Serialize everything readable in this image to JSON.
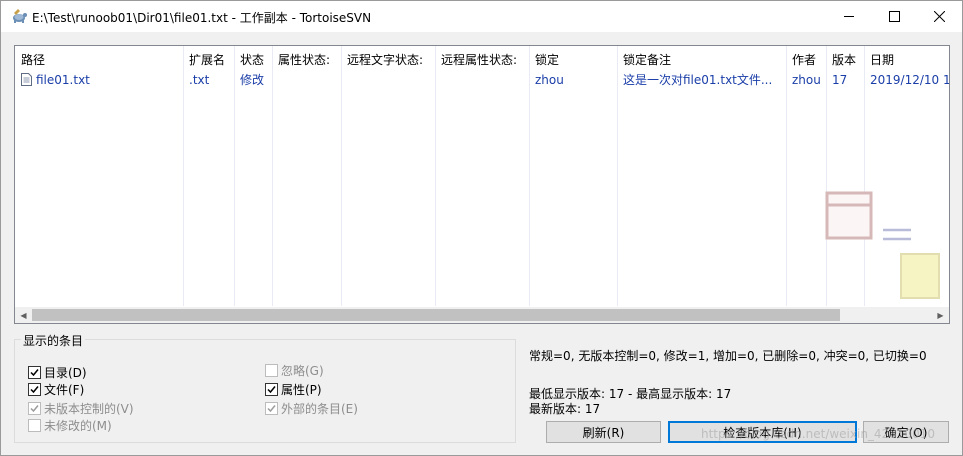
{
  "window": {
    "title": "E:\\Test\\runoob01\\Dir01\\file01.txt - 工作副本 - TortoiseSVN",
    "icon": "tortoise-icon"
  },
  "list": {
    "columns": [
      "路径",
      "扩展名",
      "状态",
      "属性状态:",
      "远程文字状态:",
      "远程属性状态:",
      "锁定",
      "锁定备注",
      "作者",
      "版本",
      "日期"
    ],
    "rows": [
      {
        "path": "file01.txt",
        "ext": ".txt",
        "status": "修改",
        "prop_status": "",
        "remote_text_status": "",
        "remote_prop_status": "",
        "lock": "zhou",
        "lock_comment": "这是一次对file01.txt文件...",
        "author": "zhou",
        "revision": "17",
        "date": "2019/12/10 1"
      }
    ]
  },
  "group": {
    "legend": "显示的条目",
    "checkboxes": {
      "dirs": {
        "label": "目录(D)",
        "checked": true,
        "enabled": true
      },
      "files": {
        "label": "文件(F)",
        "checked": true,
        "enabled": true
      },
      "unversioned": {
        "label": "未版本控制的(V)",
        "checked": true,
        "enabled": false
      },
      "unmodified": {
        "label": "未修改的(M)",
        "checked": false,
        "enabled": false
      },
      "ignored": {
        "label": "忽略(G)",
        "checked": false,
        "enabled": false
      },
      "properties": {
        "label": "属性(P)",
        "checked": true,
        "enabled": true
      },
      "externals": {
        "label": "外部的条目(E)",
        "checked": true,
        "enabled": false
      }
    }
  },
  "stats": "常规=0, 无版本控制=0, 修改=1, 增加=0, 已删除=0, 冲突=0, 已切换=0",
  "revisions": {
    "line1": "最低显示版本: 17 - 最高显示版本: 17",
    "line2": "最新版本: 17"
  },
  "buttons": {
    "refresh": "刷新(R)",
    "check_repo": "检查版本库(H)",
    "ok": "确定(O)"
  },
  "watermark": "https://blog.csdn.net/weixin_42810010",
  "colors": {
    "link_blue": "#1a3ea8",
    "focus_blue": "#0078d7"
  }
}
